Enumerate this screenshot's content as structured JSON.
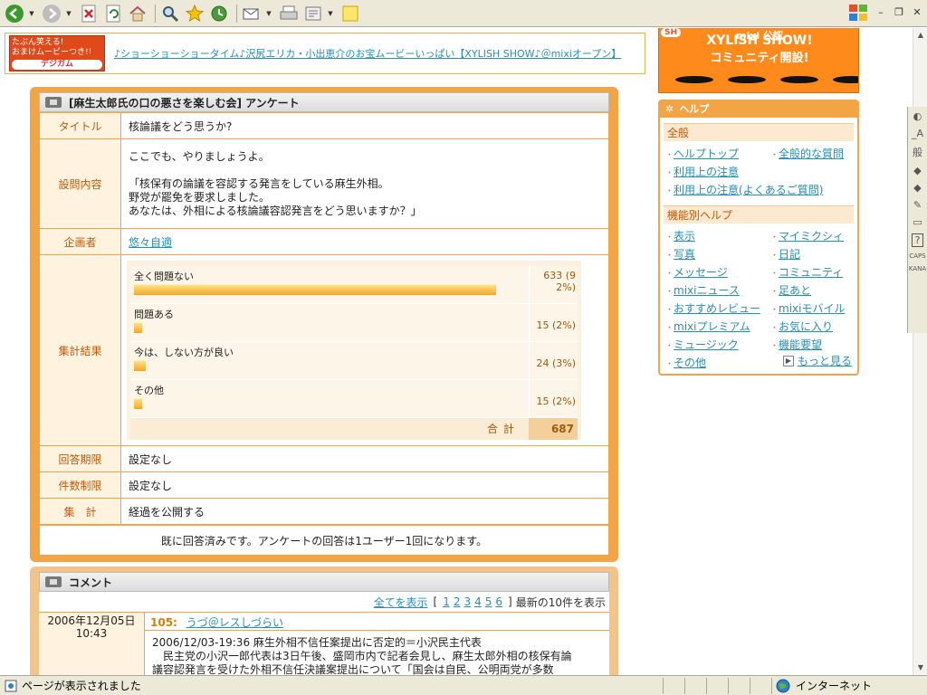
{
  "banner": {
    "img_line1": "たぶん笑える!",
    "img_line2": "おまけムービーつき!!",
    "img_brand": "デジガム",
    "link": "♪ショーショーショータイム♪沢尻エリカ・小出恵介のお宝ムービーいっぱい【XYLISH SHOW♪＠mixiオープン】"
  },
  "ad": {
    "line1": "mixi 公認",
    "line2": "XYLISH SHOW!",
    "line3": "コミュニティ開設!",
    "badge": "SH"
  },
  "survey": {
    "header": "[麻生太郎氏の口の悪さを楽しむ会] アンケート",
    "title_label": "タイトル",
    "title_value": "核論議をどう思うか?",
    "question_label": "設問内容",
    "question_lines": [
      "ここでも、やりましょうよ。",
      "",
      "「核保有の論議を容認する発言をしている麻生外相。",
      "野党が罷免を要求しました。",
      "あなたは、外相による核論議容認発言をどう思いますか？」"
    ],
    "planner_label": "企画者",
    "planner_value": "悠々自適",
    "result_label": "集計結果",
    "results": [
      {
        "label": "全く問題ない",
        "count": "633 (92%)",
        "count_a": "633 (9",
        "count_b": "2%)",
        "pct": 92
      },
      {
        "label": "問題ある",
        "count": "15 (2%)",
        "count_a": "",
        "count_b": "15 (2%)",
        "pct": 2
      },
      {
        "label": "今は、しない方が良い",
        "count": "24 (3%)",
        "count_a": "",
        "count_b": "24 (3%)",
        "pct": 3
      },
      {
        "label": "その他",
        "count": "15 (2%)",
        "count_a": "",
        "count_b": "15 (2%)",
        "pct": 2
      }
    ],
    "total_label": "合計",
    "total_value": "687",
    "deadline_label": "回答期限",
    "deadline_value": "設定なし",
    "limit_label": "件数制限",
    "limit_value": "設定なし",
    "tally_label": "集　計",
    "tally_value": "経過を公開する",
    "notice": "既に回答済みです。アンケートの回答は1ユーザー1回になります。"
  },
  "comments": {
    "header": "コメント",
    "show_all": "全てを表示",
    "pages": [
      "1",
      "2",
      "3",
      "4",
      "5",
      "6"
    ],
    "bracket_open": "[",
    "bracket_close": "]",
    "latest_note": "最新の10件を表示",
    "items": [
      {
        "date": "2006年12月05日",
        "time": "10:43",
        "number": "105:",
        "author": "うづ＠レスしづらい",
        "line1": "2006/12/03-19:36 麻生外相不信任案提出に否定的＝小沢民主代表",
        "line2": "　民主党の小沢一郎代表は3日午後、盛岡市内で記者会見し、麻生太郎外相の核保有論",
        "line3": "議容認発言を受けた外相不信任決議案提出について「国会は自民、公明両党が多数"
      }
    ]
  },
  "help": {
    "header": "ヘルプ",
    "general_title": "全般",
    "general_pairs": [
      [
        "ヘルプトップ",
        "全般的な質問"
      ]
    ],
    "general_single": [
      "利用上の注意",
      "利用上の注意(よくあるご質問)"
    ],
    "feature_title": "機能別ヘルプ",
    "feature_pairs": [
      [
        "表示",
        "マイミクシィ"
      ],
      [
        "写真",
        "日記"
      ],
      [
        "メッセージ",
        "コミュニティ"
      ],
      [
        "mixiニュース",
        "足あと"
      ],
      [
        "おすすめレビュー",
        "mixiモバイル"
      ],
      [
        "mixiプレミアム",
        "お気に入り"
      ],
      [
        "ミュージック",
        "機能要望"
      ]
    ],
    "feature_single": [
      "その他"
    ],
    "more": "もっと見る"
  },
  "sidetools": [
    "般",
    "?",
    "CAPS",
    "KANA"
  ],
  "status": {
    "text": "ページが表示されました",
    "zone": "インターネット"
  },
  "colors": {
    "accent": "#f3a445",
    "link": "#258fb8",
    "label_text": "#c25a0a"
  }
}
